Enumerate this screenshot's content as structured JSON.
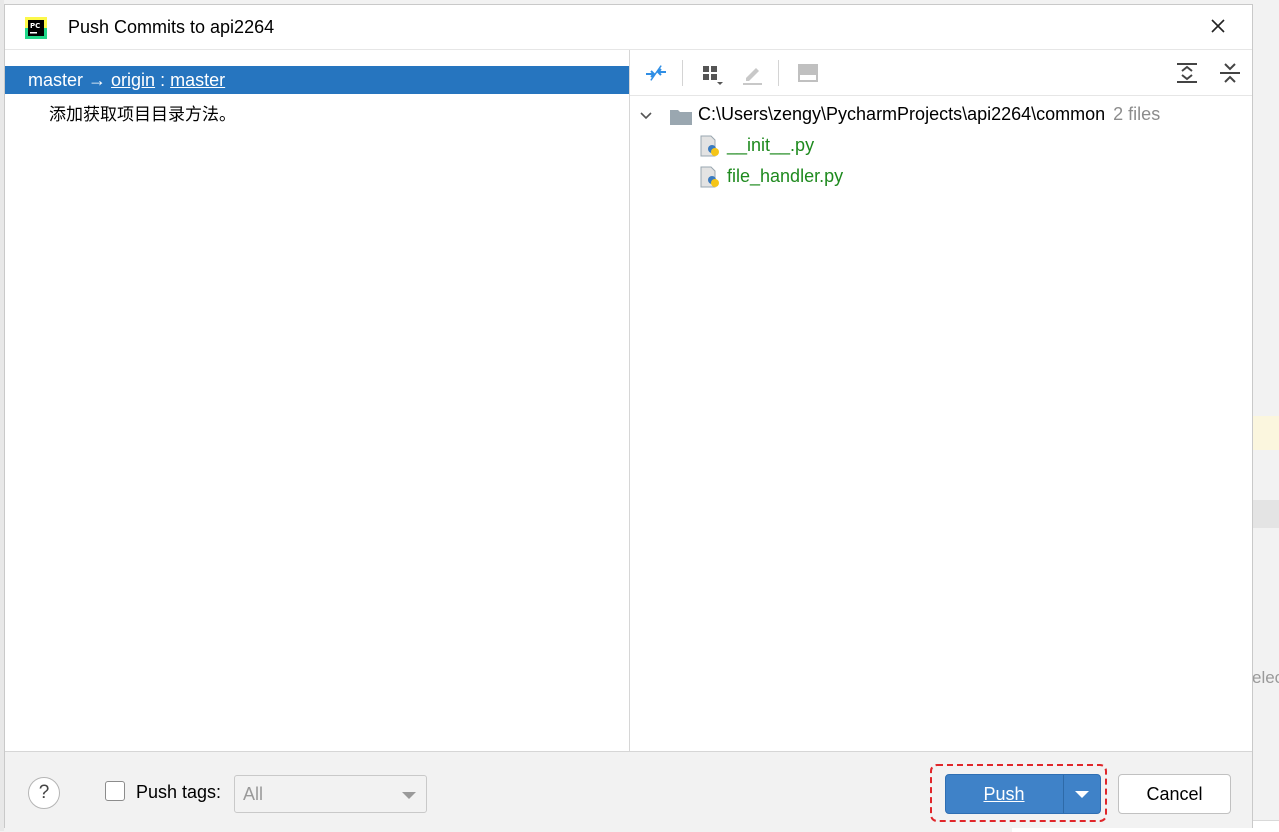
{
  "dialog": {
    "title": "Push Commits to api2264",
    "app_icon": "pycharm-logo-icon",
    "app_icon_text": "PC"
  },
  "left_pane": {
    "branch": {
      "local": "master",
      "arrow": "→",
      "remote": "origin",
      "separator": ":",
      "remote_branch": "master"
    },
    "commits": [
      "添加获取项目目录方法。"
    ]
  },
  "toolbar": {
    "icons": [
      "compare-diff-icon",
      "group-by-icon",
      "edit-source-icon",
      "show-diff-preview-icon",
      "expand-all-icon",
      "collapse-all-icon"
    ]
  },
  "tree": {
    "root_path": "C:\\Users\\zengy\\PycharmProjects\\api2264\\common",
    "root_count": "2 files",
    "files": [
      "__init__.py",
      "file_handler.py"
    ]
  },
  "footer": {
    "help_label": "?",
    "push_tags_label": "Push tags:",
    "push_tags_checked": false,
    "tags_select_value": "All",
    "push_label": "Push",
    "cancel_label": "Cancel"
  },
  "background": {
    "partial_text": "elec"
  },
  "colors": {
    "selection": "#2675bf",
    "primary_button": "#3f82c8",
    "file_added": "#1e8a1e",
    "highlight_border": "#e0262a"
  }
}
